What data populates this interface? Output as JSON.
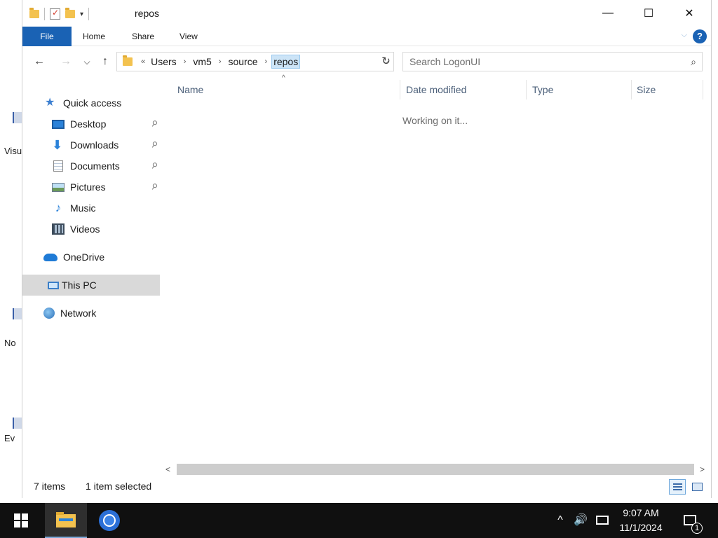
{
  "window": {
    "title": "repos",
    "qat_dropdown": "▾",
    "controls": {
      "minimize": "—",
      "maximize": "☐",
      "close": "✕"
    }
  },
  "ribbon": {
    "tabs": [
      {
        "label": "File"
      },
      {
        "label": "Home"
      },
      {
        "label": "Share"
      },
      {
        "label": "View"
      }
    ],
    "help_label": "?",
    "collapse_label": "⌵"
  },
  "navigation": {
    "back": "←",
    "forward": "→",
    "recent": "⌵",
    "up": "↑",
    "breadcrumb": {
      "overflow": "«",
      "separator": "›",
      "items": [
        "Users",
        "vm5",
        "source",
        "repos"
      ]
    },
    "address_dropdown": "⌵",
    "refresh": "↻"
  },
  "search": {
    "placeholder": "Search LogonUI",
    "icon": "⌕"
  },
  "nav_pane": {
    "items": [
      {
        "label": "Quick access",
        "icon": "star-icon",
        "pinned": false
      },
      {
        "label": "Desktop",
        "icon": "desktop-icon",
        "pinned": true
      },
      {
        "label": "Downloads",
        "icon": "download-icon",
        "pinned": true
      },
      {
        "label": "Documents",
        "icon": "document-icon",
        "pinned": true
      },
      {
        "label": "Pictures",
        "icon": "picture-icon",
        "pinned": true
      },
      {
        "label": "Music",
        "icon": "music-icon",
        "pinned": false
      },
      {
        "label": "Videos",
        "icon": "video-icon",
        "pinned": false
      },
      {
        "label": "OneDrive",
        "icon": "cloud-icon",
        "pinned": false
      },
      {
        "label": "This PC",
        "icon": "computer-icon",
        "pinned": false,
        "selected": true
      },
      {
        "label": "Network",
        "icon": "network-icon",
        "pinned": false
      }
    ],
    "pin_glyph": "📌"
  },
  "content": {
    "columns": [
      "Name",
      "Date modified",
      "Type",
      "Size"
    ],
    "sort_indicator": "^",
    "message": "Working on it..."
  },
  "scrollbar": {
    "left": "<",
    "right": ">"
  },
  "status": {
    "item_count": "7 items",
    "selection": "1 item selected"
  },
  "desktop": {
    "labels": [
      "Visu",
      "No",
      "Ev"
    ]
  },
  "taskbar": {
    "time": "9:07 AM",
    "date": "11/1/2024",
    "notifications_count": "1",
    "tray_up": "^",
    "volume": "🔊"
  },
  "colors": {
    "accent": "#1a62b4",
    "selection": "#cce4f7",
    "taskbar": "#101010"
  }
}
